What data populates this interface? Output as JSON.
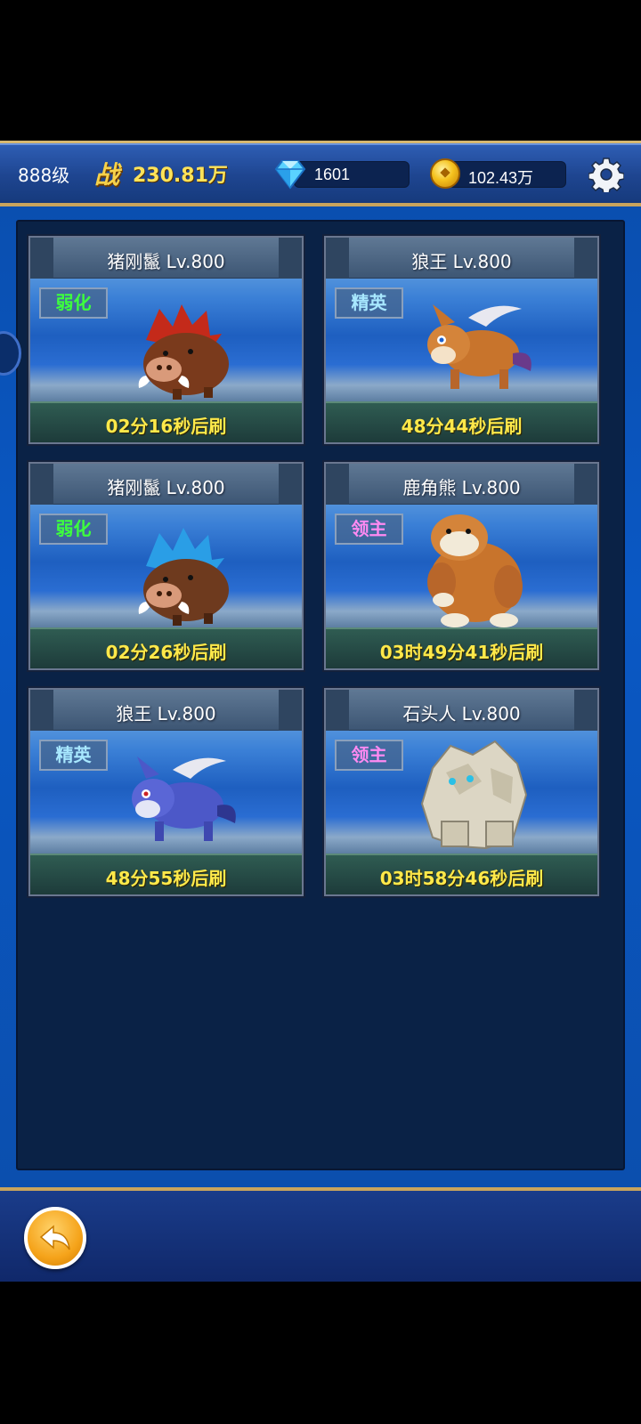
{
  "topbar": {
    "level": "888级",
    "power_icon": "战",
    "power_value": "230.81万",
    "gems": "1601",
    "gold": "102.43万"
  },
  "icons": {
    "gem": "diamond-icon",
    "gold": "gold-coin-icon",
    "settings": "gear-icon",
    "back": "back-arrow-icon"
  },
  "monsters": [
    {
      "name": "猪刚鬣 Lv.800",
      "tag": "弱化",
      "timer": "02分16秒后刷",
      "kind": "boar-red"
    },
    {
      "name": "狼王 Lv.800",
      "tag": "精英",
      "timer": "48分44秒后刷",
      "kind": "wolf-brown"
    },
    {
      "name": "猪刚鬣 Lv.800",
      "tag": "弱化",
      "timer": "02分26秒后刷",
      "kind": "boar-blue"
    },
    {
      "name": "鹿角熊 Lv.800",
      "tag": "领主",
      "timer": "03时49分41秒后刷",
      "kind": "bear"
    },
    {
      "name": "狼王 Lv.800",
      "tag": "精英",
      "timer": "48分55秒后刷",
      "kind": "wolf-blue"
    },
    {
      "name": "石头人 Lv.800",
      "tag": "领主",
      "timer": "03时58分46秒后刷",
      "kind": "golem"
    }
  ],
  "colors": {
    "tag_weak": "#3dff3d",
    "tag_elite": "#a8e8ff",
    "tag_boss": "#ff8af2",
    "timer": "#ffe94a",
    "power": "#ffe35a"
  }
}
